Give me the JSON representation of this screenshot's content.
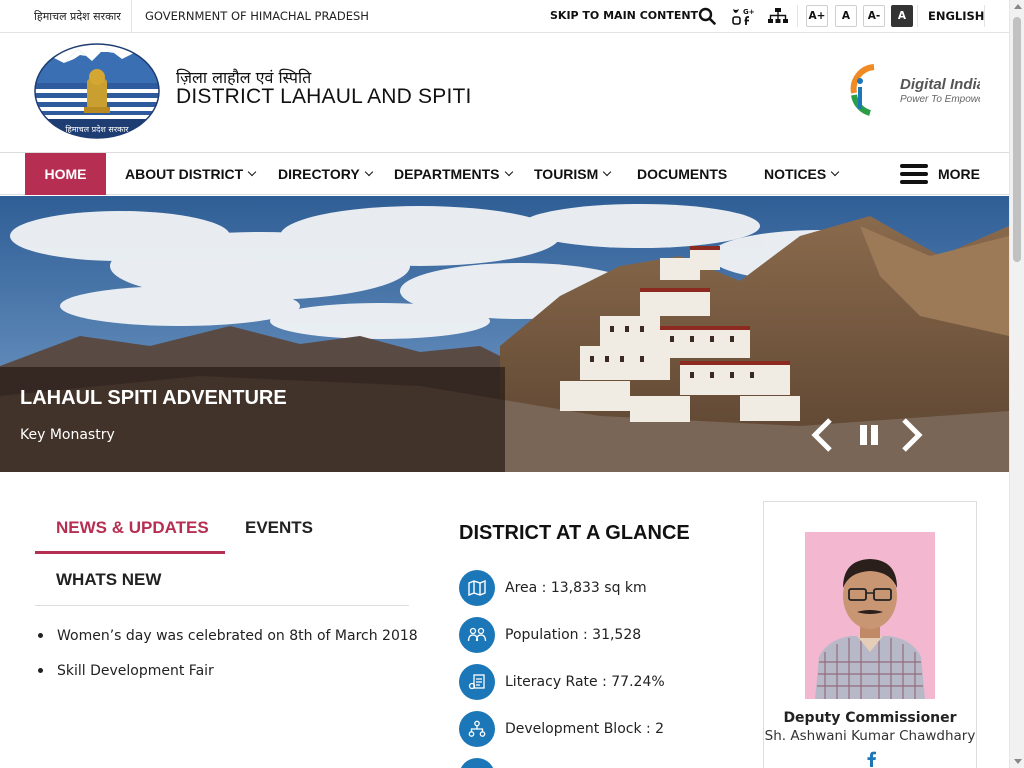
{
  "topbar": {
    "gov_hindi": "हिमाचल प्रदेश सरकार",
    "gov_english": "GOVERNMENT OF HIMACHAL PRADESH",
    "skip_link": "SKIP TO MAIN CONTENT",
    "font_increase": "A+",
    "font_normal": "A",
    "font_decrease": "A-",
    "high_contrast": "A",
    "language": "ENGLISH",
    "social_icon_label": "G+"
  },
  "header": {
    "title_hindi": "ज़िला लाहौल एवं स्पिति",
    "title_english": "DISTRICT LAHAUL AND SPITI",
    "emblem_caption": "हिमाचल प्रदेश सरकार",
    "digital_india_title": "Digital India",
    "digital_india_tagline": "Power To Empower"
  },
  "nav": {
    "items": [
      {
        "label": "HOME",
        "active": true
      },
      {
        "label": "ABOUT DISTRICT"
      },
      {
        "label": "DIRECTORY"
      },
      {
        "label": "DEPARTMENTS"
      },
      {
        "label": "TOURISM"
      },
      {
        "label": "DOCUMENTS"
      },
      {
        "label": "NOTICES"
      }
    ],
    "more_label": "MORE"
  },
  "banner": {
    "title": "LAHAUL SPITI ADVENTURE",
    "caption": "Key Monastry"
  },
  "news": {
    "tabs": [
      "NEWS & UPDATES",
      "EVENTS",
      "WHATS NEW"
    ],
    "items": [
      "Women’s day was celebrated on 8th of March 2018",
      "Skill Development Fair"
    ]
  },
  "glance": {
    "title": "DISTRICT AT A GLANCE",
    "rows": [
      {
        "label": "Area : 13,833 sq km",
        "icon": "map-icon"
      },
      {
        "label": "Population : 31,528",
        "icon": "people-icon"
      },
      {
        "label": "Literacy Rate : 77.24%",
        "icon": "literacy-icon"
      },
      {
        "label": "Development Block : 2",
        "icon": "hierarchy-icon"
      }
    ]
  },
  "dc": {
    "role": "Deputy Commissioner",
    "name": "Sh. Ashwani Kumar Chawdhary"
  },
  "colors": {
    "accent": "#b62e51",
    "icon_blue": "#1b77b7"
  }
}
